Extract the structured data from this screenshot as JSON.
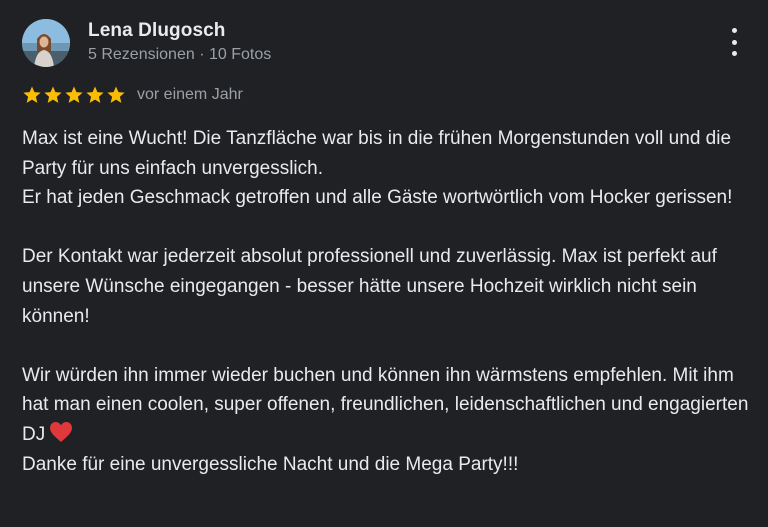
{
  "review": {
    "author": {
      "name": "Lena Dlugosch",
      "meta": "5 Rezensionen · 10 Fotos",
      "avatar_icon": "profile-photo"
    },
    "rating": {
      "stars": 5,
      "max_stars": 5,
      "star_color": "#fbbc04",
      "date": "vor einem Jahr"
    },
    "more_icon": "more-vert-icon",
    "text": {
      "line1": "Max ist eine Wucht! Die Tanzfläche war bis in die frühen Morgenstunden voll und die Party für uns einfach unvergesslich.",
      "line2": "Er hat jeden Geschmack getroffen und alle Gäste wortwörtlich vom Hocker gerissen!",
      "line3": "Der Kontakt war jederzeit absolut professionell und zuverlässig. Max ist perfekt auf unsere Wünsche eingegangen - besser hätte unsere Hochzeit wirklich nicht sein können!",
      "line4": "Wir würden ihn immer wieder buchen und können ihn wärmstens empfehlen. Mit ihm hat man einen coolen, super offenen, freundlichen, leidenschaftlichen und engagierten DJ",
      "line5": "Danke für eine unvergessliche Nacht und die Mega Party!!!",
      "emoji_icon": "red-heart-icon"
    }
  },
  "colors": {
    "background": "#202124",
    "text_primary": "#e8eaed",
    "text_secondary": "#9aa0a6",
    "heart": "#e0383b"
  }
}
